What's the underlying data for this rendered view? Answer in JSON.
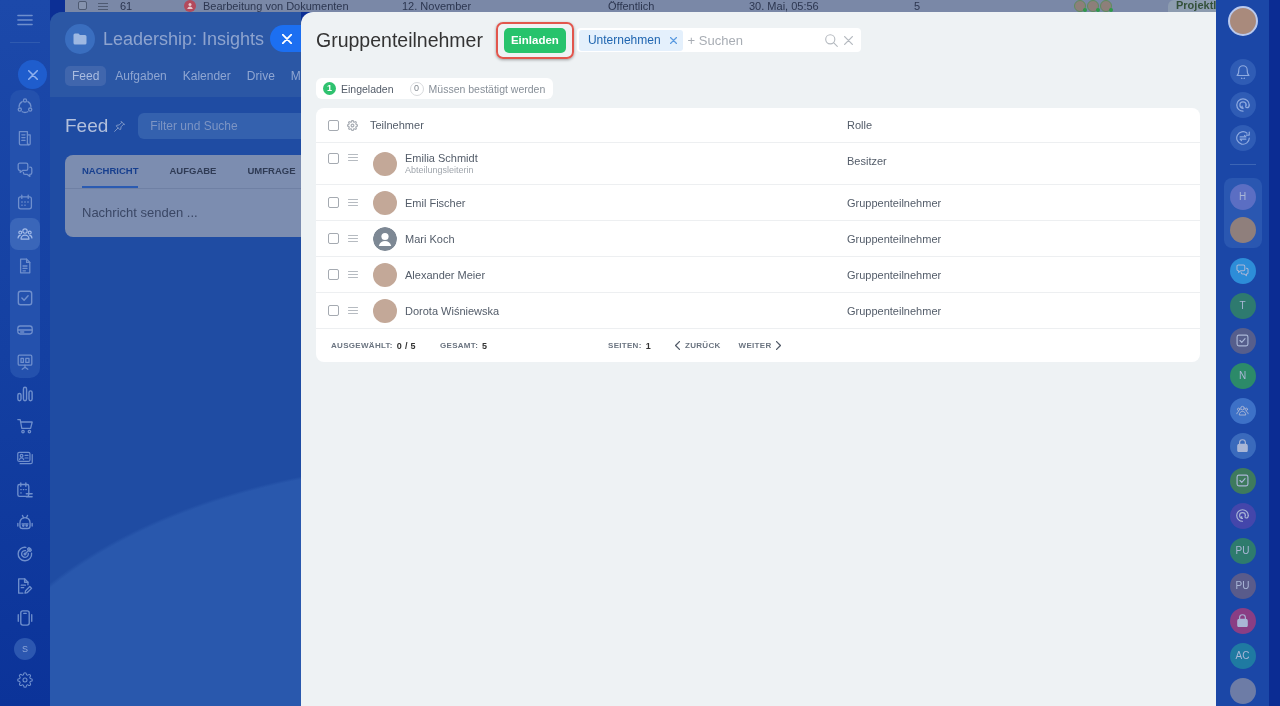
{
  "background_row": {
    "checked": false,
    "number": "61",
    "title": "Bearbeitung von Dokumenten",
    "date": "12. November",
    "visibility": "Öffentlich",
    "modified": "30. Mai, 05:56",
    "count": "5",
    "tag": "Projektl"
  },
  "left_sidebar": {
    "pinned": [
      {
        "selected": false
      },
      {
        "selected": false
      },
      {
        "selected": false
      },
      {
        "selected": false
      },
      {
        "selected": true
      },
      {
        "selected": false
      },
      {
        "selected": false
      },
      {
        "selected": false
      },
      {
        "selected": false
      }
    ],
    "more": [
      {
        "selected": false
      },
      {
        "selected": false
      },
      {
        "selected": false
      },
      {
        "selected": false
      },
      {
        "selected": false
      },
      {
        "selected": false
      },
      {
        "selected": false
      },
      {
        "selected": false
      }
    ],
    "account_initial": "S"
  },
  "group_panel": {
    "title": "Leadership: Insights",
    "tabs": [
      {
        "label": "Feed",
        "selected": true
      },
      {
        "label": "Aufgaben",
        "selected": false
      },
      {
        "label": "Kalender",
        "selected": false
      },
      {
        "label": "Drive",
        "selected": false
      },
      {
        "label": "M",
        "selected": false
      }
    ],
    "feed_title": "Feed",
    "filter": {
      "placeholder": "Filter und Suche"
    },
    "composer": {
      "tabs": [
        {
          "label": "NACHRICHT",
          "selected": true
        },
        {
          "label": "AUFGABE",
          "selected": false
        },
        {
          "label": "UMFRAGE",
          "selected": false
        }
      ],
      "placeholder": "Nachricht senden ..."
    }
  },
  "dialog": {
    "title": "Gruppenteilnehmer",
    "invite_button": {
      "label": "Einladen",
      "highlighted": true
    },
    "filter": {
      "tags": [
        {
          "label": "Unternehmen"
        }
      ],
      "placeholder": "+ Suchen"
    },
    "counters": [
      {
        "kind": "filled",
        "count": "1",
        "label": "Eingeladen"
      },
      {
        "kind": "outline",
        "count": "0",
        "label": "Müssen bestätigt werden"
      }
    ],
    "table": {
      "all_checked": false,
      "columns": [
        {
          "label": "Teilnehmer"
        },
        {
          "label": "Rolle"
        }
      ],
      "rows": [
        {
          "kind": "photo",
          "checked": false,
          "name": "Emilia Schmidt",
          "position": "Abteilungsleiterin",
          "role": "Besitzer"
        },
        {
          "kind": "photo",
          "checked": false,
          "name": "Emil Fischer",
          "role": "Gruppenteilnehmer"
        },
        {
          "kind": "default",
          "checked": false,
          "name": "Mari Koch",
          "role": "Gruppenteilnehmer"
        },
        {
          "kind": "photo",
          "checked": false,
          "name": "Alexander Meier",
          "role": "Gruppenteilnehmer"
        },
        {
          "kind": "photo",
          "checked": false,
          "name": "Dorota Wiśniewska",
          "role": "Gruppenteilnehmer"
        }
      ],
      "footer": {
        "selected": {
          "label": "AUSGEWÄHLT:",
          "value": "0 / 5"
        },
        "total": {
          "label": "GESAMT:",
          "value": "5"
        },
        "pages": {
          "label": "SEITEN:",
          "value": "1"
        },
        "previous": "ZURÜCK",
        "next": "WEITER"
      }
    }
  },
  "right_sidebar": {
    "pinned": [
      {
        "kind": "initials",
        "initials": "H",
        "color": "#5b6ec3"
      },
      {
        "kind": "photo"
      }
    ],
    "chats": [
      {
        "kind": "general",
        "color": "#2d8dd8"
      },
      {
        "kind": "initials",
        "initials": "T",
        "color": "#2e7a6f"
      },
      {
        "kind": "task",
        "color": "#565e8c"
      },
      {
        "kind": "initials",
        "initials": "N",
        "color": "#2c8a69"
      },
      {
        "kind": "team",
        "color": "#3d71c7"
      },
      {
        "kind": "closed",
        "color": "#3a6abc"
      },
      {
        "kind": "task",
        "color": "#3e7a5d"
      },
      {
        "kind": "ai",
        "color": "#4446ab"
      },
      {
        "kind": "initials",
        "initials": "PU",
        "color": "#2e7b6d"
      },
      {
        "kind": "initials",
        "initials": "PU",
        "color": "#595b8b"
      },
      {
        "kind": "closed",
        "color": "#8a3e84"
      },
      {
        "kind": "initials",
        "initials": "AC",
        "color": "#1f7aa2"
      },
      {
        "kind": "crowd"
      }
    ]
  }
}
